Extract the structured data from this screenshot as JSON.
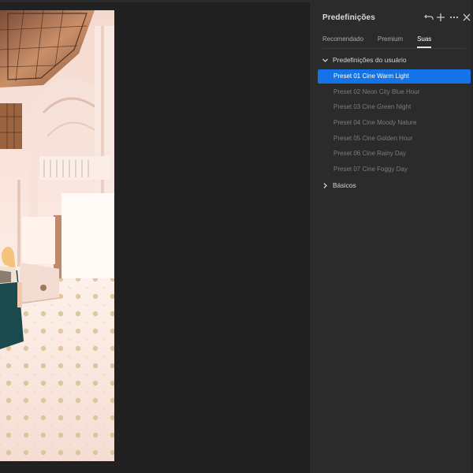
{
  "panel": {
    "title": "Predefinições",
    "icons": [
      "undo-icon",
      "plus-icon",
      "more-icon",
      "close-icon"
    ]
  },
  "tabs": [
    {
      "label": "Recomendado",
      "active": false
    },
    {
      "label": "Premium",
      "active": false
    },
    {
      "label": "Suas",
      "active": true
    }
  ],
  "groups": {
    "user": {
      "label": "Predefinições do usuário",
      "expanded": true
    },
    "basics": {
      "label": "Básicos",
      "expanded": false
    }
  },
  "presets": [
    {
      "label": "Preset 01 Cine Warm Light",
      "selected": true
    },
    {
      "label": "Preset 02 Neon City Blue Hour",
      "selected": false
    },
    {
      "label": "Preset 03 Cine Green Night",
      "selected": false
    },
    {
      "label": "Preset 04 Cine Moody Nature",
      "selected": false
    },
    {
      "label": "Preset 05 Cine Golden Hour",
      "selected": false
    },
    {
      "label": "Preset 06 Cine Rainy Day",
      "selected": false
    },
    {
      "label": "Preset 07 Cine Foggy Day",
      "selected": false
    }
  ],
  "colors": {
    "accent": "#1473e6",
    "panel_bg": "#2b2b2b",
    "canvas_bg": "#212121"
  }
}
